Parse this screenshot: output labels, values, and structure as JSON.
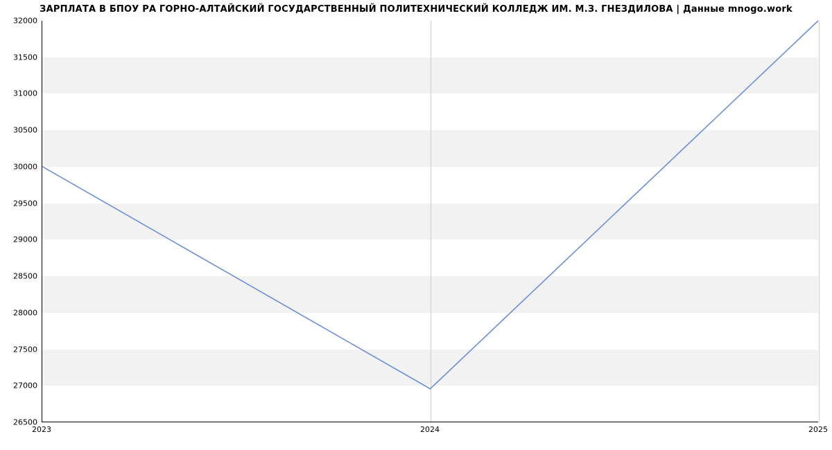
{
  "chart_data": {
    "type": "line",
    "title": "ЗАРПЛАТА В БПОУ РА ГОРНО-АЛТАЙСКИЙ ГОСУДАРСТВЕННЫЙ ПОЛИТЕХНИЧЕСКИЙ КОЛЛЕДЖ ИМ. М.З. ГНЕЗДИЛОВА | Данные mnogo.work",
    "x": [
      2023,
      2024,
      2025
    ],
    "values": [
      30000,
      26950,
      32000
    ],
    "xlabel": "",
    "ylabel": "",
    "xlim": [
      2023,
      2025
    ],
    "ylim": [
      26500,
      32000
    ],
    "x_ticks": [
      2023,
      2024,
      2025
    ],
    "y_ticks": [
      26500,
      27000,
      27500,
      28000,
      28500,
      29000,
      29500,
      30000,
      30500,
      31000,
      31500,
      32000
    ],
    "line_color": "#6a8fd8",
    "band_color": "#f2f2f2"
  }
}
